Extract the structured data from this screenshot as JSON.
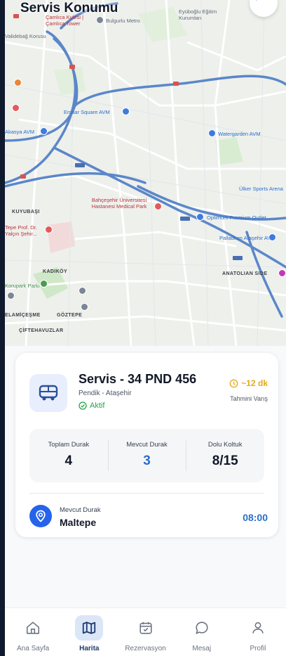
{
  "header": {
    "title": "Servis Konumu"
  },
  "map": {
    "labels": {
      "camlica": "Çamlıca Kulesi | Çamlıca Tower",
      "bulgurlu": "Bulgurlu Metro",
      "eyuboglu": "Eyüboğlu Eğitim Kurumları",
      "validebag": "Validebağ Korusu",
      "emaar": "Emaar Square AVM",
      "akasya": "Akasya AVM",
      "watergarden": "Watergarden AVM",
      "ulker": "Ülker Sports Arena",
      "bahcesehir": "Bahçeşehir Üniversitesi Hastanesi Medical Park",
      "kuyubasi": "KUYUBAŞI",
      "optimum": "Optimum Premium Outlet",
      "palladium": "Palladium Ataşehir AVM",
      "yalcin": "Tepe Prof. Dr. Yalçın Şehir...",
      "kadikoy": "KADIKÖY",
      "anatolian": "ANATOLIAN SIDE",
      "korupark": "Korupark Parkı",
      "elamicesme": "ELAMİÇEŞME",
      "goztepe": "GÖZTEPE",
      "ciftehavuzlar": "ÇİFTEHAVUZLAR",
      "d100": "D100"
    }
  },
  "vehicle": {
    "title": "Servis - 34 PND 456",
    "route": "Pendik - Ataşehir",
    "status": "Aktif",
    "eta": "~12 dk",
    "eta_label": "Tahmini Varış"
  },
  "stats": [
    {
      "label": "Toplam Durak",
      "value": "4"
    },
    {
      "label": "Mevcut Durak",
      "value": "3"
    },
    {
      "label": "Dolu Koltuk",
      "value": "8/15"
    }
  ],
  "current_stop": {
    "label": "Mevcut Durak",
    "name": "Maltepe",
    "time": "08:00"
  },
  "nav": [
    {
      "label": "Ana Sayfa",
      "icon": "home-icon"
    },
    {
      "label": "Harita",
      "icon": "map-icon",
      "active": true
    },
    {
      "label": "Rezervasyon",
      "icon": "calendar-icon"
    },
    {
      "label": "Mesaj",
      "icon": "message-icon"
    },
    {
      "label": "Profil",
      "icon": "user-icon"
    }
  ],
  "colors": {
    "accent": "#2563eb",
    "active_green": "#22a34a",
    "eta_yellow": "#e5a91a",
    "nav_active_bg": "#dbe6f7"
  }
}
